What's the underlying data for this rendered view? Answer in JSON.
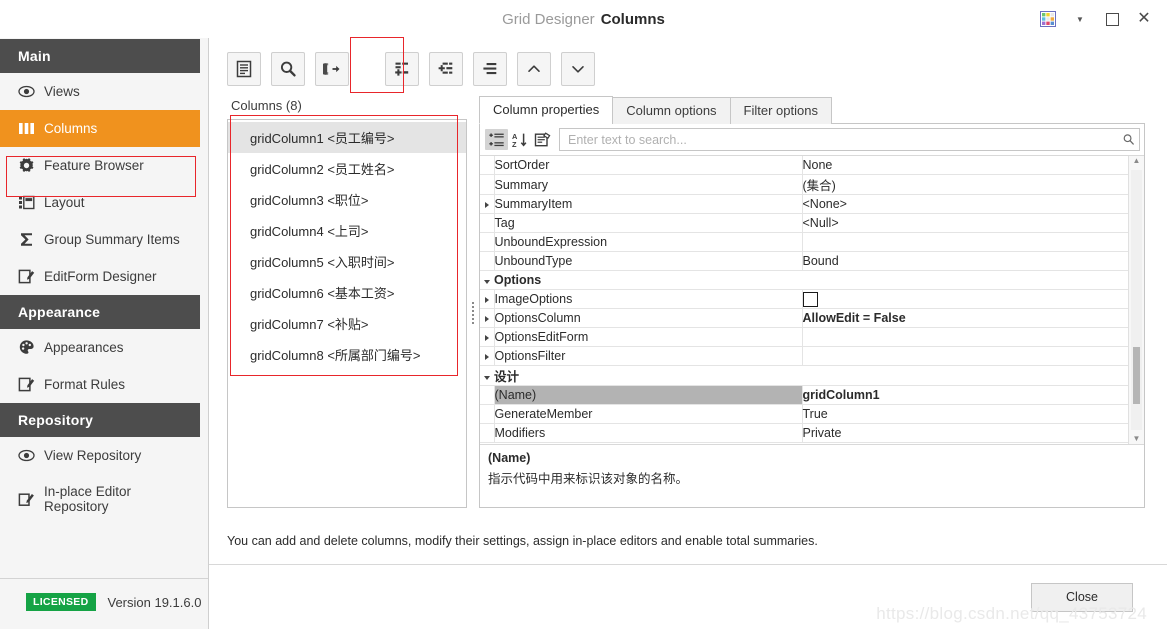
{
  "window": {
    "title_app": "Grid Designer",
    "title_page": "Columns",
    "skin_icon": "skin-grid-icon",
    "dropdown_icon": "chevron-down-icon",
    "maximize_icon": "maximize-icon",
    "close_icon": "close-icon"
  },
  "sidebar": {
    "groups": [
      {
        "label": "Main",
        "items": [
          {
            "label": "Views",
            "icon": "eye-icon",
            "selected": false
          },
          {
            "label": "Columns",
            "icon": "columns-icon",
            "selected": true
          },
          {
            "label": "Feature Browser",
            "icon": "gear-icon",
            "selected": false
          },
          {
            "label": "Layout",
            "icon": "layout-icon",
            "selected": false
          },
          {
            "label": "Group Summary Items",
            "icon": "sigma-icon",
            "selected": false
          },
          {
            "label": "EditForm Designer",
            "icon": "edit-form-icon",
            "selected": false
          }
        ]
      },
      {
        "label": "Appearance",
        "items": [
          {
            "label": "Appearances",
            "icon": "palette-icon",
            "selected": false
          },
          {
            "label": "Format Rules",
            "icon": "format-rules-icon",
            "selected": false
          }
        ]
      },
      {
        "label": "Repository",
        "items": [
          {
            "label": "View Repository",
            "icon": "eye-icon",
            "selected": false
          },
          {
            "label": "In-place Editor\nRepository",
            "icon": "inplace-editor-icon",
            "selected": false
          }
        ]
      }
    ],
    "footer": {
      "license_badge": "LICENSED",
      "version": "Version 19.1.6.0"
    }
  },
  "toolbar": {
    "buttons": [
      {
        "name": "show-grid-button",
        "icon": "list-panel-icon"
      },
      {
        "name": "retrieve-fields-button",
        "icon": "search-icon"
      },
      {
        "name": "run-designer-button",
        "icon": "export-icon"
      },
      {
        "name": "add-column-button",
        "icon": "add-column-icon",
        "highlighted": true
      },
      {
        "name": "add-banded-column-button",
        "icon": "add-banded-icon"
      },
      {
        "name": "delete-column-button",
        "icon": "remove-column-icon"
      },
      {
        "name": "move-up-button",
        "icon": "chevron-up-icon"
      },
      {
        "name": "move-down-button",
        "icon": "chevron-down-icon"
      }
    ]
  },
  "columns_panel": {
    "label": "Columns (8)",
    "items": [
      {
        "text": "gridColumn1 <员工编号>",
        "selected": true
      },
      {
        "text": "gridColumn2 <员工姓名>",
        "selected": false
      },
      {
        "text": "gridColumn3 <职位>",
        "selected": false
      },
      {
        "text": "gridColumn4 <上司>",
        "selected": false
      },
      {
        "text": "gridColumn5 <入职时间>",
        "selected": false
      },
      {
        "text": "gridColumn6 <基本工资>",
        "selected": false
      },
      {
        "text": "gridColumn7 <补贴>",
        "selected": false
      },
      {
        "text": "gridColumn8 <所属部门编号>",
        "selected": false
      }
    ]
  },
  "property_panel": {
    "tabs": [
      {
        "label": "Column properties",
        "active": true
      },
      {
        "label": "Column options",
        "active": false
      },
      {
        "label": "Filter options",
        "active": false
      }
    ],
    "grid_toolbar": [
      {
        "name": "categorized-button",
        "icon": "categorized-icon",
        "active": true
      },
      {
        "name": "alphabetical-button",
        "icon": "sort-alpha-icon",
        "active": false
      },
      {
        "name": "property-pages-button",
        "icon": "property-pages-icon",
        "active": false
      }
    ],
    "search": {
      "placeholder": "Enter text to search...",
      "value": "",
      "icon": "search-icon"
    },
    "rows": [
      {
        "kind": "prop",
        "expander": "none",
        "name": "SortOrder",
        "value": "None",
        "bold": false,
        "selected": false
      },
      {
        "kind": "prop",
        "expander": "none",
        "name": "Summary",
        "value": "(集合)",
        "bold": false,
        "selected": false
      },
      {
        "kind": "prop",
        "expander": "right",
        "name": "SummaryItem",
        "value": "<None>",
        "bold": false,
        "selected": false
      },
      {
        "kind": "prop",
        "expander": "none",
        "name": "Tag",
        "value": "<Null>",
        "bold": false,
        "selected": false
      },
      {
        "kind": "prop",
        "expander": "none",
        "name": "UnboundExpression",
        "value": "",
        "bold": false,
        "selected": false
      },
      {
        "kind": "prop",
        "expander": "none",
        "name": "UnboundType",
        "value": "Bound",
        "bold": false,
        "selected": false
      },
      {
        "kind": "cat",
        "expander": "down",
        "name": "Options",
        "value": "",
        "bold": true,
        "selected": false
      },
      {
        "kind": "prop",
        "expander": "right",
        "name": "ImageOptions",
        "value": "",
        "bold": false,
        "selected": false,
        "swatch": true
      },
      {
        "kind": "prop",
        "expander": "right",
        "name": "OptionsColumn",
        "value": "AllowEdit = False",
        "bold": true,
        "selected": false
      },
      {
        "kind": "prop",
        "expander": "right",
        "name": "OptionsEditForm",
        "value": "",
        "bold": false,
        "selected": false
      },
      {
        "kind": "prop",
        "expander": "right",
        "name": "OptionsFilter",
        "value": "",
        "bold": false,
        "selected": false
      },
      {
        "kind": "cat",
        "expander": "down",
        "name": "设计",
        "value": "",
        "bold": true,
        "selected": false
      },
      {
        "kind": "prop",
        "expander": "none",
        "name": "(Name)",
        "value": "gridColumn1",
        "bold": true,
        "selected": true
      },
      {
        "kind": "prop",
        "expander": "none",
        "name": "GenerateMember",
        "value": "True",
        "bold": false,
        "selected": false
      },
      {
        "kind": "prop",
        "expander": "none",
        "name": "Modifiers",
        "value": "Private",
        "bold": false,
        "selected": false
      }
    ],
    "scrollbar": {
      "up_icon": "scroll-up-icon",
      "down_icon": "scroll-down-icon"
    },
    "description": {
      "title": "(Name)",
      "text": "指示代码中用来标识该对象的名称。"
    }
  },
  "footer": {
    "hint": "You can add and delete columns, modify their settings, assign in-place editors and enable total summaries.",
    "close_label": "Close",
    "watermark": "https://blog.csdn.net/qq_43753724"
  }
}
